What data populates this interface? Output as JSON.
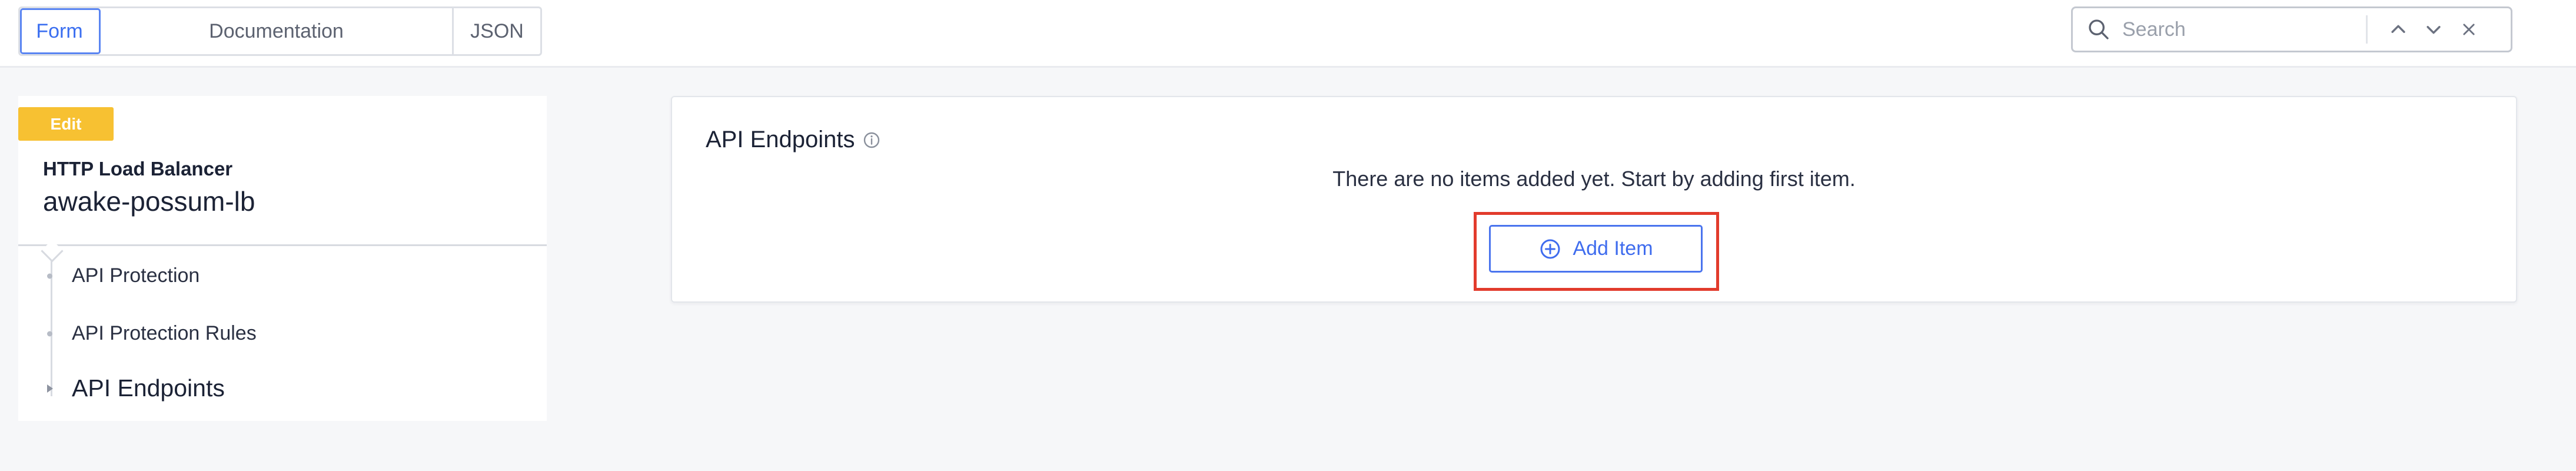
{
  "view_tabs": [
    {
      "label": "Form",
      "active": true
    },
    {
      "label": "Documentation",
      "active": false
    },
    {
      "label": "JSON",
      "active": false
    }
  ],
  "search": {
    "placeholder": "Search",
    "value": "",
    "icons": [
      "search-icon",
      "chevron-up-icon",
      "chevron-down-icon",
      "close-icon"
    ]
  },
  "sidebar": {
    "badge": "Edit",
    "entity_type": "HTTP Load Balancer",
    "entity_name": "awake-possum-lb",
    "items": [
      {
        "label": "API Protection"
      },
      {
        "label": "API Protection Rules"
      },
      {
        "label": "API Endpoints",
        "current": true
      }
    ]
  },
  "main": {
    "section_title": "API Endpoints",
    "title_icon": "info-icon",
    "empty_message": "There are no items added yet. Start by adding first item.",
    "add_button_label": "Add Item",
    "add_button_icon": "plus-circle-icon"
  },
  "colors": {
    "accent": "#3f6cee",
    "badge": "#f7c132",
    "highlight": "#e23b2c"
  }
}
